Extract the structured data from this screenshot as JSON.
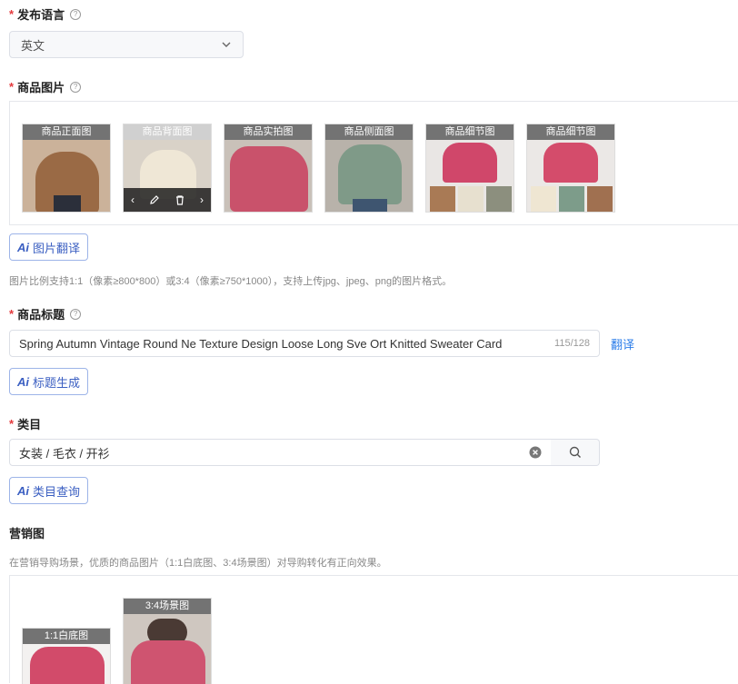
{
  "language": {
    "label": "发布语言",
    "value": "英文"
  },
  "images": {
    "label": "商品图片",
    "items": [
      {
        "tag": "商品正面图",
        "bg": "#cbb29a",
        "fig": "#9a6a45"
      },
      {
        "tag": "商品背面图",
        "bg": "#d9d2c8",
        "fig": "#efe7d6"
      },
      {
        "tag": "商品实拍图",
        "bg": "#c9c1b9",
        "fig": "#c9526b"
      },
      {
        "tag": "商品侧面图",
        "bg": "#b8b2aa",
        "fig": "#7f9a88"
      },
      {
        "tag": "商品细节图",
        "bg": "#e9e6e4",
        "fig": "#d0476a"
      },
      {
        "tag": "商品细节图",
        "bg": "#ebe8e6",
        "fig": "#d44c6b"
      }
    ],
    "translate_button": "图片翻译",
    "hint": "图片比例支持1:1（像素≥800*800）或3:4（像素≥750*1000），支持上传jpg、jpeg、png的图片格式。"
  },
  "title": {
    "label": "商品标题",
    "value": "Spring Autumn Vintage Round Ne Texture Design Loose Long Sve Ort Knitted Sweater Card",
    "counter": "115/128",
    "translate_link": "翻译",
    "generate_button": "标题生成"
  },
  "category": {
    "label": "类目",
    "value": "女装 / 毛衣 / 开衫",
    "query_button": "类目查询"
  },
  "marketing": {
    "label": "营销图",
    "hint": "在营销导购场景，优质的商品图片（1:1白底图、3:4场景图）对导购转化有正向效果。",
    "items": [
      {
        "tag": "1:1白底图"
      },
      {
        "tag": "3:4场景图"
      }
    ]
  },
  "ai_text": "Ai",
  "colors": {
    "accent": "#3b5fc2",
    "required": "#e4393c",
    "link": "#2b7de9"
  }
}
